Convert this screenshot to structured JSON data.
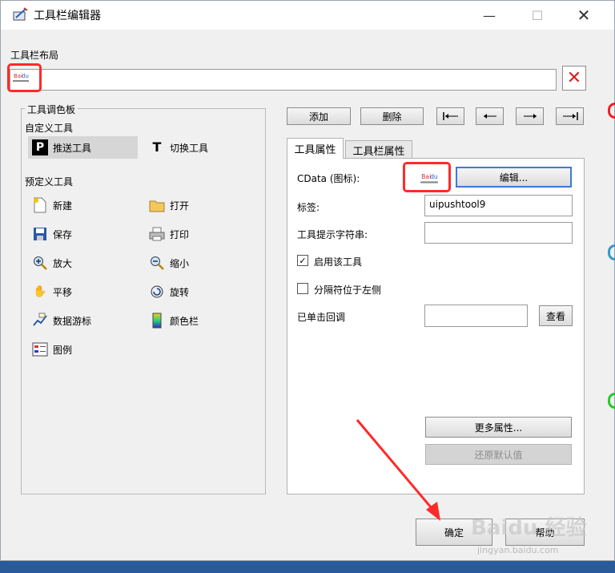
{
  "window": {
    "title": "工具栏编辑器"
  },
  "layout_section": {
    "label": "工具栏布局"
  },
  "palette": {
    "title": "工具调色板",
    "custom_title": "自定义工具",
    "custom_tools": [
      {
        "label": "推送工具",
        "icon": "push-tool-icon"
      },
      {
        "label": "切换工具",
        "icon": "toggle-tool-icon"
      }
    ],
    "predefined_title": "预定义工具",
    "predefined_tools": [
      {
        "label": "新建",
        "icon": "new-icon"
      },
      {
        "label": "打开",
        "icon": "open-folder-icon"
      },
      {
        "label": "保存",
        "icon": "save-icon"
      },
      {
        "label": "打印",
        "icon": "print-icon"
      },
      {
        "label": "放大",
        "icon": "zoom-in-icon"
      },
      {
        "label": "缩小",
        "icon": "zoom-out-icon"
      },
      {
        "label": "平移",
        "icon": "pan-hand-icon"
      },
      {
        "label": "旋转",
        "icon": "rotate-icon"
      },
      {
        "label": "数据游标",
        "icon": "data-cursor-icon"
      },
      {
        "label": "颜色栏",
        "icon": "colorbar-icon"
      },
      {
        "label": "图例",
        "icon": "legend-icon"
      }
    ]
  },
  "toolbar_buttons": {
    "add": "添加",
    "delete": "删除"
  },
  "tabs": [
    {
      "label": "工具属性"
    },
    {
      "label": "工具栏属性"
    }
  ],
  "props": {
    "cdata_label": "CData (图标):",
    "edit_button": "编辑...",
    "tag_label": "标签:",
    "tag_value": "uipushtool9",
    "tooltip_label": "工具提示字符串:",
    "tooltip_value": "",
    "enable_label": "启用该工具",
    "enable_checked": true,
    "separator_label": "分隔符位于左侧",
    "separator_checked": false,
    "callback_label": "已单击回调",
    "callback_value": "",
    "view_button": "查看",
    "more_button": "更多属性...",
    "restore_button": "还原默认值"
  },
  "footer": {
    "ok": "确定",
    "help": "帮助"
  },
  "watermark": {
    "text": "Baidu 经验",
    "sub": "jingyan.baidu.com"
  }
}
